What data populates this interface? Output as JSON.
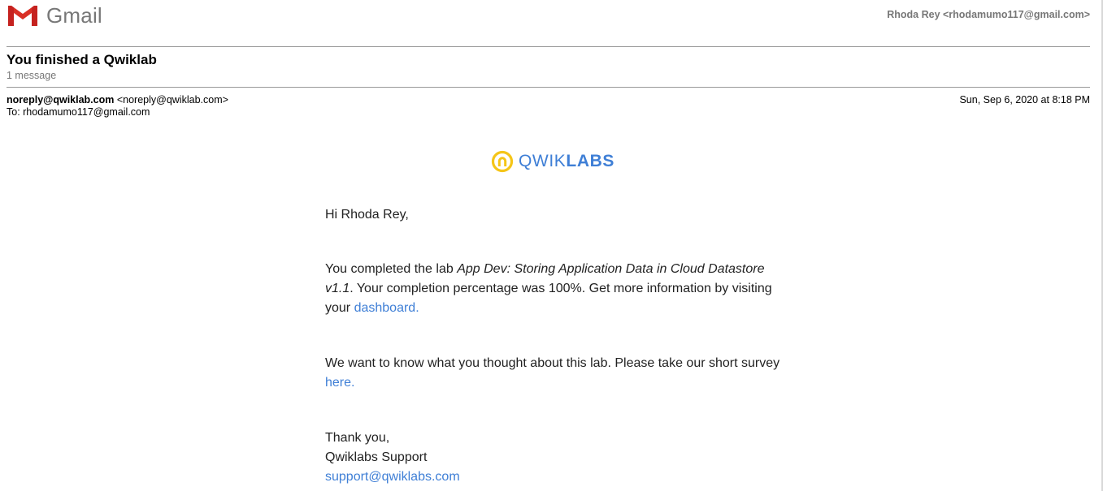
{
  "header": {
    "app_name": "Gmail",
    "account": "Rhoda Rey <rhodamumo117@gmail.com>"
  },
  "thread": {
    "subject": "You finished a Qwiklab",
    "count": "1 message"
  },
  "message": {
    "from_name": "noreply@qwiklab.com",
    "from_addr": "<noreply@qwiklab.com>",
    "to": "To: rhodamumo117@gmail.com",
    "date": "Sun, Sep 6, 2020 at 8:18 PM"
  },
  "email": {
    "brand_light": "QWIK",
    "brand_bold": "LABS",
    "greeting": "Hi Rhoda Rey,",
    "p1_pre": "You completed the lab ",
    "p1_lab": "App Dev: Storing Application Data in Cloud Datastore v1.1",
    "p1_mid": ". Your completion percentage was 100%. Get more information by visiting your ",
    "p1_link": "dashboard.",
    "p2_pre": "We want to know what you thought about this lab. Please take our short survey ",
    "p2_link": "here.",
    "thanks": "Thank you,",
    "team": "Qwiklabs Support",
    "support_email": "support@qwiklabs.com"
  },
  "icons": {
    "gmail_logo": "gmail-logo-icon",
    "qwiklabs_logo": "qwiklabs-logo-icon"
  },
  "colors": {
    "gmail_red": "#d93025",
    "link_blue": "#3f7fd6",
    "qwiklabs_yellow": "#f5c518",
    "muted_gray": "#777777"
  }
}
